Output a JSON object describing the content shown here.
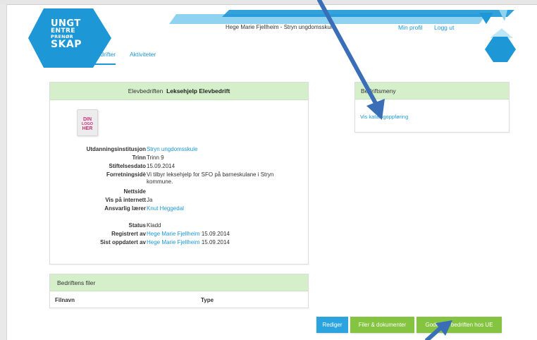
{
  "logo": {
    "line1": "UNGT",
    "line2": "ENTRE",
    "line3": "PRENØR",
    "line4": "SKAP"
  },
  "header": {
    "user_school": "Hege Marie Fjellheim - Stryn ungdomsskule",
    "profile_link": "Min profil",
    "logout_link": "Logg ut"
  },
  "nav": {
    "tab_companies": "Bedrifter",
    "tab_activities": "Aktiviteter"
  },
  "company": {
    "header_prefix": "Elevbedriften",
    "name": "Leksehjelp Elevbedrift",
    "logo_placeholder": [
      "DIN",
      "LOGO",
      "HER"
    ],
    "fields": [
      {
        "label": "Utdanningsinstitusjon",
        "value": "Stryn ungdomsskule"
      },
      {
        "label": "Trinn",
        "value": "Trinn 9"
      },
      {
        "label": "Stiftelsesdato",
        "value": "15.09.2014"
      },
      {
        "label": "Forretningsidè",
        "value": "Vi tilbyr leksehjelp for SFO på barneskulane i Stryn kommune."
      },
      {
        "label": "Nettside",
        "value": ""
      },
      {
        "label": "Vis på internett",
        "value": "Ja"
      },
      {
        "label": "Ansvarlig lærer",
        "value": "Knut Heggedal"
      },
      {
        "label": "Status",
        "value": "Kladd"
      },
      {
        "label": "Registrert av",
        "value_link": "Hege Marie Fjellheim",
        "value_date": "15.09.2014"
      },
      {
        "label": "Sist oppdatert av",
        "value_link": "Hege Marie Fjellheim",
        "value_date": "15.09.2014"
      }
    ]
  },
  "files": {
    "title": "Bedriftens filer",
    "col_name": "Filnavn",
    "col_type": "Type"
  },
  "menu": {
    "title": "Bedriftsmeny",
    "item": "Vis katalogoppføring"
  },
  "buttons": {
    "edit": "Rediger",
    "files_docs": "Filer & dokumenter",
    "approve": "Godkjenn bedriften hos UE"
  },
  "colors": {
    "brand_blue": "#1e97d6",
    "header_green": "#d4efc9",
    "button_green": "#84c440",
    "button_blue": "#2aa3de",
    "annotation_arrow": "#3a6fb8"
  }
}
